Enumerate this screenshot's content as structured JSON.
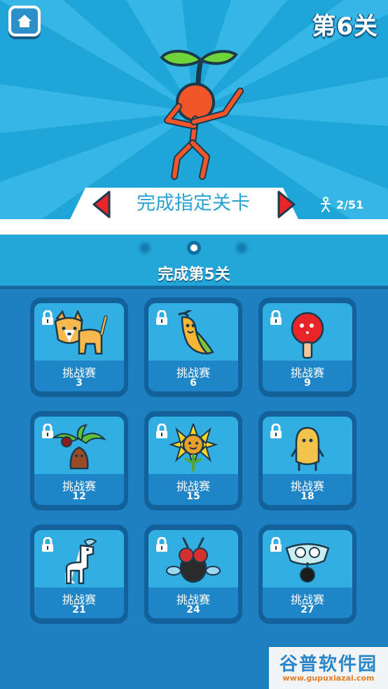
{
  "header": {
    "level_title": "第6关",
    "home_icon": "home-icon"
  },
  "banner": {
    "text": "完成指定关卡",
    "left_arrow_icon": "arrow-left-icon",
    "right_arrow_icon": "arrow-right-icon"
  },
  "progress": {
    "icon": "stickman-icon",
    "text": "2/51"
  },
  "pager": {
    "pages": 3,
    "active_index": 1
  },
  "section": {
    "title": "完成第5关"
  },
  "challenges": [
    {
      "label": "挑战赛",
      "number": "3",
      "creature": "corgi-icon",
      "locked": true
    },
    {
      "label": "挑战赛",
      "number": "6",
      "creature": "banana-icon",
      "locked": true
    },
    {
      "label": "挑战赛",
      "number": "9",
      "creature": "ping-pong-paddle-icon",
      "locked": true
    },
    {
      "label": "挑战赛",
      "number": "12",
      "creature": "coconut-tree-icon",
      "locked": true
    },
    {
      "label": "挑战赛",
      "number": "15",
      "creature": "sunflower-icon",
      "locked": true
    },
    {
      "label": "挑战赛",
      "number": "18",
      "creature": "potato-icon",
      "locked": true
    },
    {
      "label": "挑战赛",
      "number": "21",
      "creature": "llama-icon",
      "locked": true
    },
    {
      "label": "挑战赛",
      "number": "24",
      "creature": "fly-icon",
      "locked": true
    },
    {
      "label": "挑战赛",
      "number": "27",
      "creature": "goggles-bomb-icon",
      "locked": true
    }
  ],
  "watermark": {
    "title": "谷普软件园",
    "url": "www.gupuxiazai.com"
  },
  "colors": {
    "sky": "#1fa6d8",
    "card_outer": "#13619a",
    "card_inner": "#1e86c8",
    "arrow_red": "#e8262a",
    "mascot_orange": "#f2552a",
    "leaf_green": "#6fd33a"
  }
}
